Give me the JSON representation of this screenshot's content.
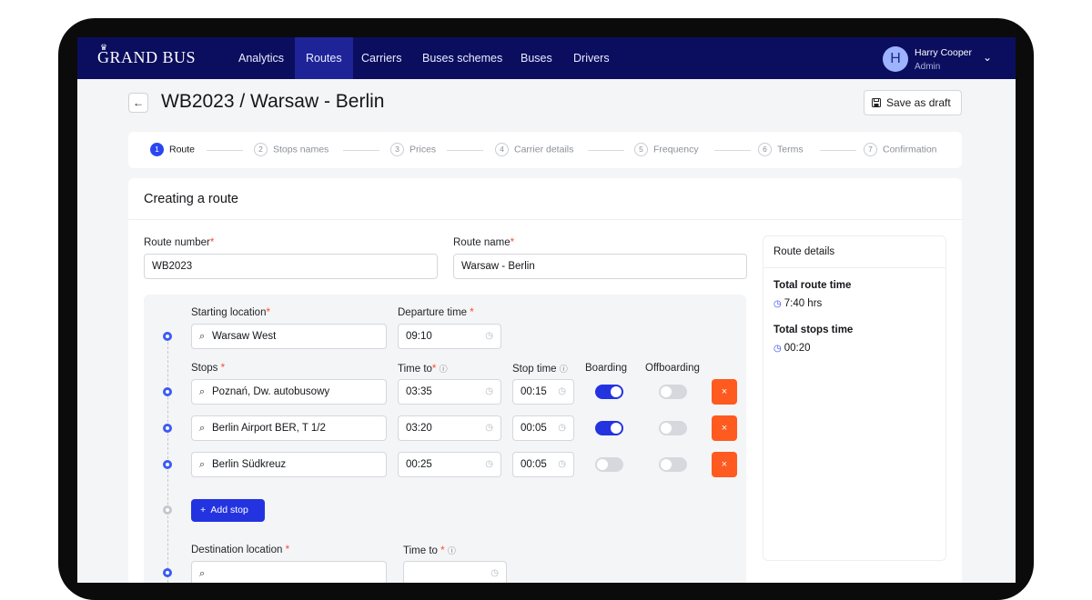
{
  "nav": {
    "logo": "GRAND BUS",
    "items": [
      "Analytics",
      "Routes",
      "Carriers",
      "Buses schemes",
      "Buses",
      "Drivers"
    ],
    "active": "Routes",
    "user_name": "Harry Cooper",
    "user_role": "Admin",
    "avatar_initial": "H"
  },
  "header": {
    "back_icon": "←",
    "title": "WB2023 / Warsaw - Berlin",
    "save_draft": "Save as draft"
  },
  "stepper": [
    {
      "num": "1",
      "label": "Route",
      "active": true
    },
    {
      "num": "2",
      "label": "Stops names",
      "active": false
    },
    {
      "num": "3",
      "label": "Prices",
      "active": false
    },
    {
      "num": "4",
      "label": "Carrier details",
      "active": false
    },
    {
      "num": "5",
      "label": "Frequency",
      "active": false
    },
    {
      "num": "6",
      "label": "Terms",
      "active": false
    },
    {
      "num": "7",
      "label": "Confirmation",
      "active": false
    }
  ],
  "form": {
    "card_title": "Creating a route",
    "route_number_label": "Route number",
    "route_number_value": "WB2023",
    "route_name_label": "Route name",
    "route_name_value": "Warsaw - Berlin",
    "required_mark": "*",
    "starting_location_label": "Starting location",
    "starting_location_value": "Warsaw West",
    "departure_time_label": "Departure time",
    "departure_time_value": "09:10",
    "stops_label": "Stops",
    "time_to_label": "Time to",
    "stop_time_label": "Stop time",
    "boarding_label": "Boarding",
    "offboarding_label": "Offboarding",
    "stops": [
      {
        "name": "Poznań, Dw. autobusowy",
        "time_to": "03:35",
        "stop_time": "00:15",
        "boarding": true,
        "offboarding": false
      },
      {
        "name": "Berlin Airport BER, T 1/2",
        "time_to": "03:20",
        "stop_time": "00:05",
        "boarding": true,
        "offboarding": false
      },
      {
        "name": "Berlin Südkreuz",
        "time_to": "00:25",
        "stop_time": "00:05",
        "boarding": false,
        "offboarding": false
      }
    ],
    "add_stop": "Add stop",
    "add_icon": "+",
    "delete_icon": "×",
    "destination_label": "Destination location",
    "destination_time_label": "Time to"
  },
  "route_details": {
    "title": "Route details",
    "total_route_time_label": "Total route time",
    "total_route_time_value": "7:40 hrs",
    "total_stops_time_label": "Total stops time",
    "total_stops_time_value": "00:20"
  },
  "colors": {
    "nav_bg": "#0b0e5e",
    "primary": "#2433e0",
    "danger": "#ff5a1f",
    "required": "#ff4a2b"
  }
}
